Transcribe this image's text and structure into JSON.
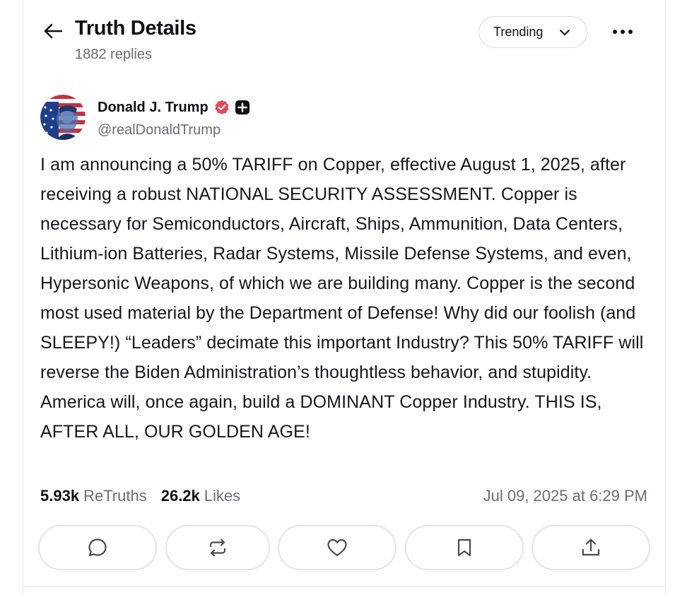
{
  "header": {
    "title": "Truth Details",
    "replies_count": "1882 replies",
    "sort_label": "Trending"
  },
  "author": {
    "name": "Donald J. Trump",
    "handle": "@realDonaldTrump",
    "verified": true
  },
  "post": {
    "text": "I am announcing a 50% TARIFF on Copper, effective August 1, 2025, after receiving a robust NATIONAL SECURITY ASSESSMENT. Copper is necessary for Semiconductors, Aircraft, Ships, Ammunition, Data Centers, Lithium-ion Batteries, Radar Systems, Missile Defense Systems, and even, Hypersonic Weapons, of which we are building many. Copper is the second most used material by the Department of Defense! Why did our foolish (and SLEEPY!) “Leaders” decimate this important Industry? This 50% TARIFF will reverse the Biden Administration’s thoughtless behavior, and stupidity. America will, once again, build a DOMINANT Copper Industry. THIS IS, AFTER ALL, OUR GOLDEN AGE!",
    "retruths_count": "5.93k",
    "retruths_label": "ReTruths",
    "likes_count": "26.2k",
    "likes_label": "Likes",
    "timestamp": "Jul 09, 2025 at 6:29 PM"
  },
  "actions": [
    "reply-icon",
    "retruth-icon",
    "like-icon",
    "bookmark-icon",
    "share-icon"
  ],
  "colors": {
    "verified_badge": "#e5485d",
    "muted_text": "#6b6b78",
    "border": "#e4e4e9"
  }
}
